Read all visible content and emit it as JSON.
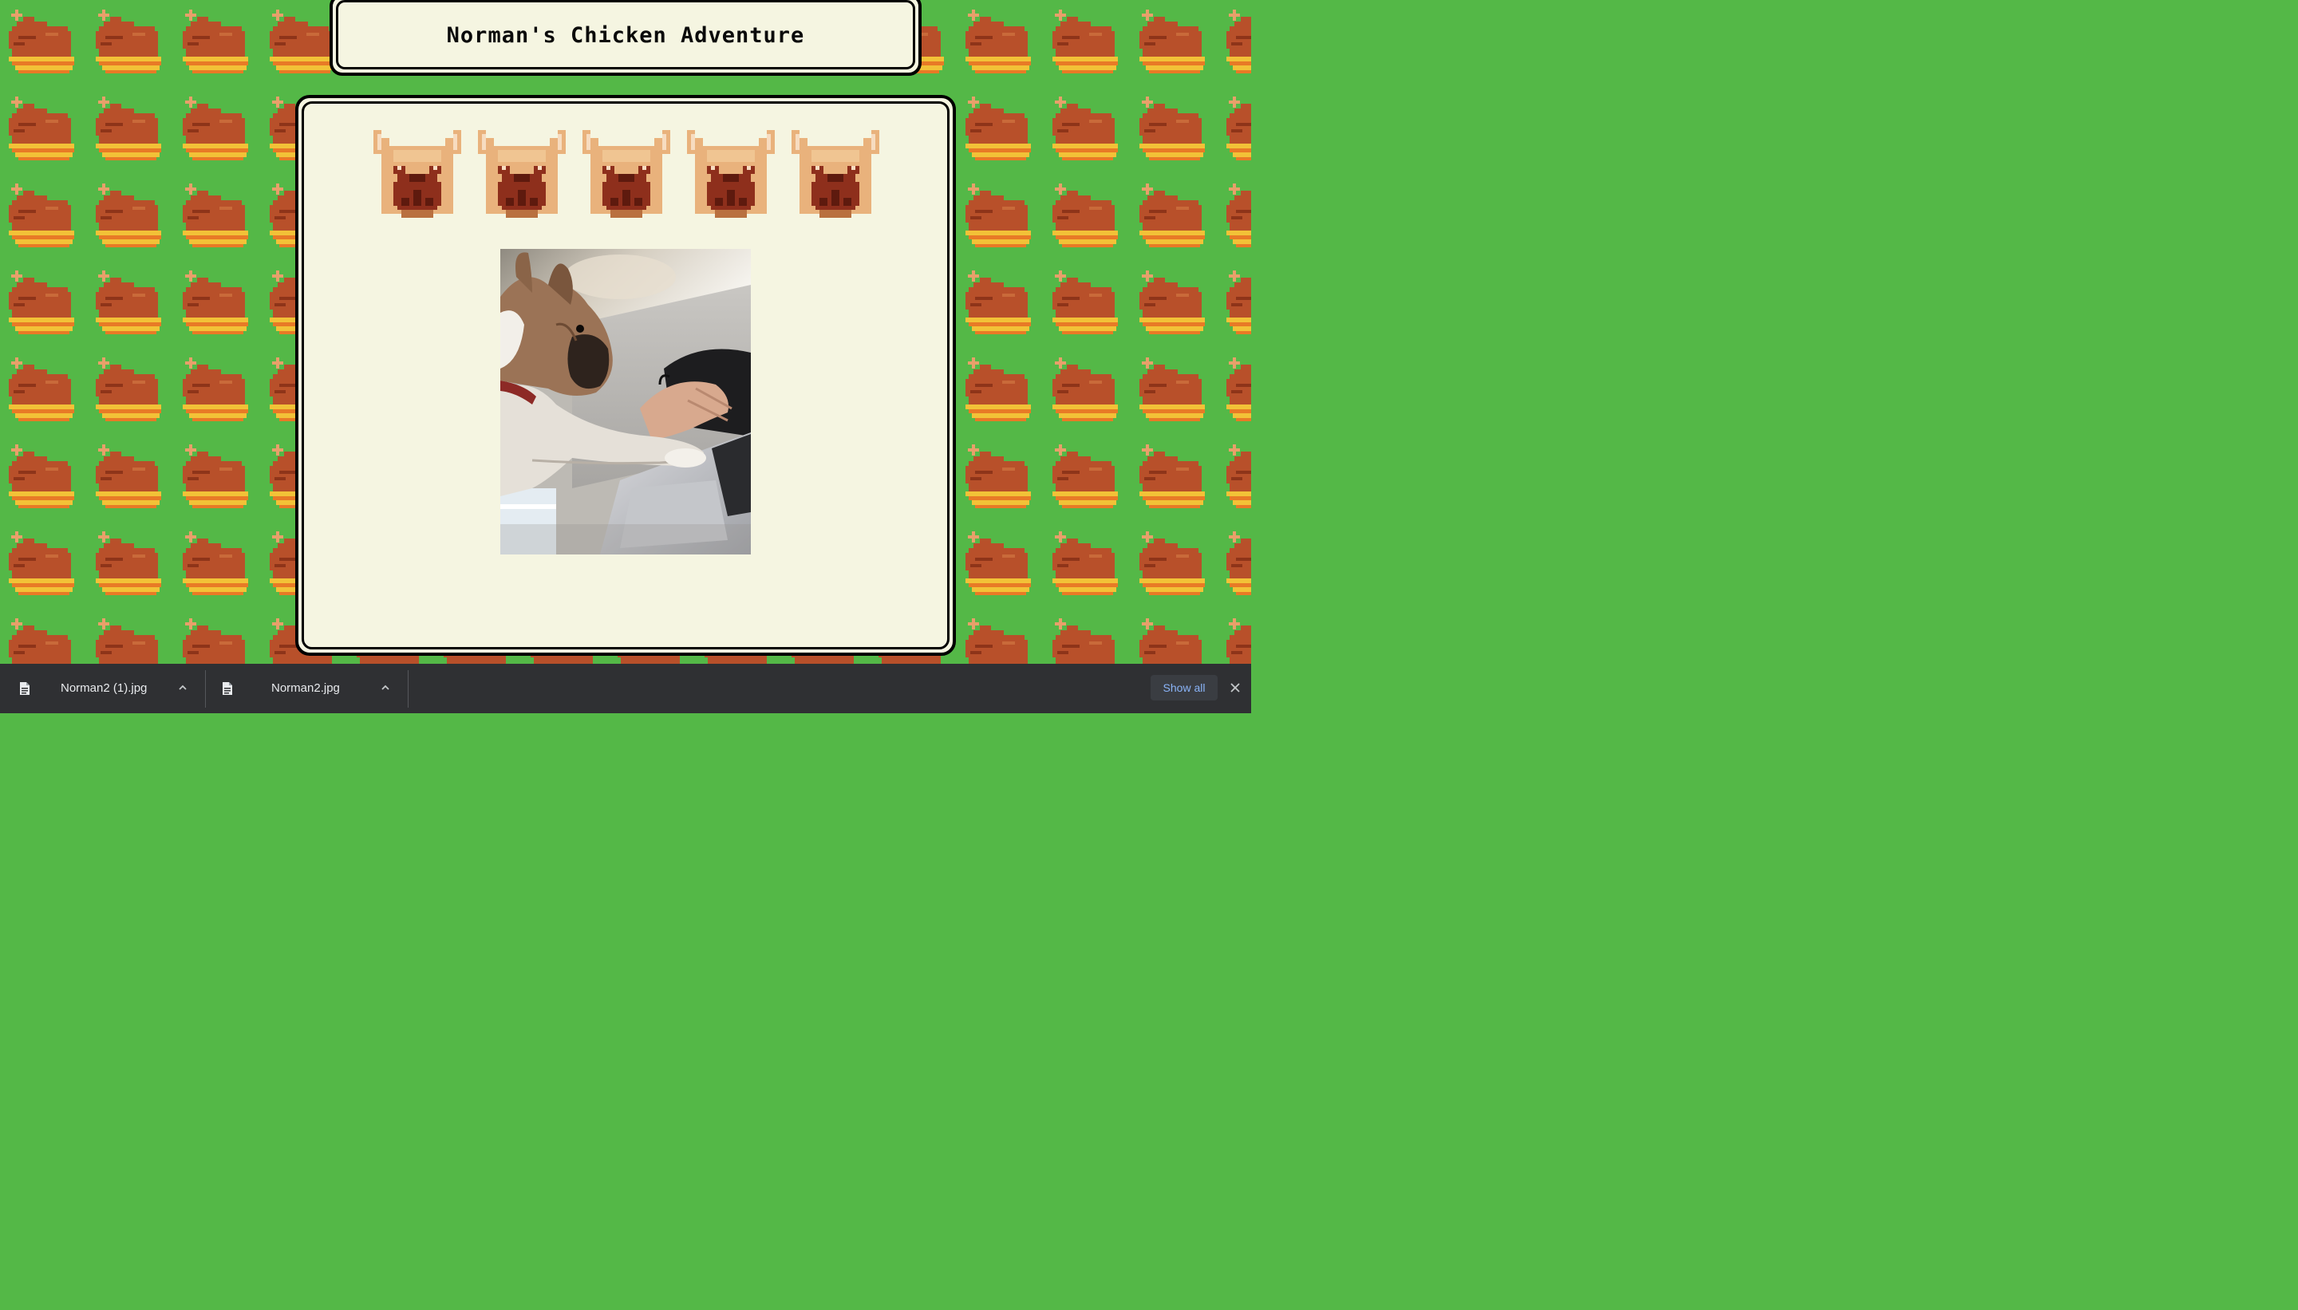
{
  "page": {
    "title": "Norman's Chicken Adventure"
  },
  "lives": {
    "count": 5,
    "icon": "pixel-bulldog-face-icon"
  },
  "photo": {
    "subject": "photo"
  },
  "downloads": {
    "items": [
      {
        "name": "Norman2 (1).jpg",
        "icon": "file-icon"
      },
      {
        "name": "Norman2.jpg",
        "icon": "file-icon"
      }
    ],
    "show_all_label": "Show all",
    "close_icon": "close-icon"
  },
  "colors": {
    "background_green": "#54b847",
    "chicken_brown": "#b8502a",
    "panel_cream": "#f5f5e1",
    "shelf_dark": "#2f3033",
    "link_blue": "#8ab4f8"
  }
}
